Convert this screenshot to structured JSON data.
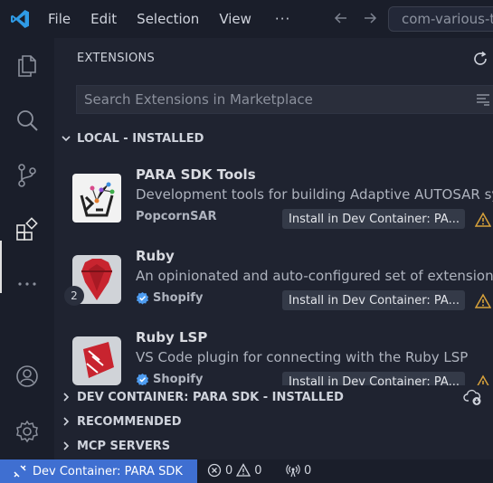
{
  "titlebar": {
    "menu": [
      "File",
      "Edit",
      "Selection",
      "View"
    ],
    "more": "···",
    "command_center": "com-various-ty"
  },
  "activity": {
    "badge_count": "2"
  },
  "sidebar": {
    "title": "EXTENSIONS",
    "search_placeholder": "Search Extensions in Marketplace",
    "sections": {
      "local": "LOCAL - INSTALLED",
      "dev_container": "DEV CONTAINER: PARA SDK - INSTALLED",
      "recommended": "RECOMMENDED",
      "mcp": "MCP SERVERS"
    },
    "extensions": [
      {
        "name": "PARA SDK Tools",
        "description": "Development tools for building Adaptive AUTOSAR sys",
        "publisher": "PopcornSAR",
        "verified": false,
        "install_label": "Install in Dev Container: PA..."
      },
      {
        "name": "Ruby",
        "description": "An opinionated and auto-configured set of extensions",
        "publisher": "Shopify",
        "verified": true,
        "install_label": "Install in Dev Container: PA..."
      },
      {
        "name": "Ruby LSP",
        "description": "VS Code plugin for connecting with the Ruby LSP",
        "publisher": "Shopify",
        "verified": true,
        "install_label": "Install in Dev Container: PA..."
      }
    ]
  },
  "statusbar": {
    "remote": "Dev Container: PARA SDK",
    "errors": "0",
    "warnings": "0",
    "ports": "0"
  },
  "colors": {
    "accent": "#3f6fd1",
    "background": "#1f2330",
    "chrome": "#1a1e2a",
    "warning": "#d7a13b",
    "verified": "#4e9cf0"
  }
}
